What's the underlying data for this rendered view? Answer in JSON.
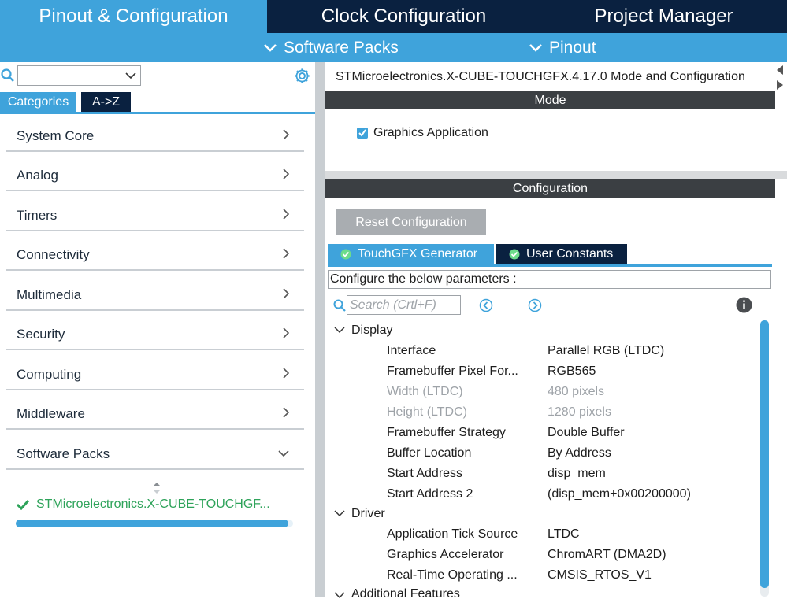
{
  "top_tabs": [
    "Pinout & Configuration",
    "Clock Configuration",
    "Project Manager"
  ],
  "subbar": {
    "software_packs": "Software Packs",
    "pinout": "Pinout"
  },
  "left": {
    "tab_categories": "Categories",
    "tab_az": "A->Z",
    "categories": [
      "System Core",
      "Analog",
      "Timers",
      "Connectivity",
      "Multimedia",
      "Security",
      "Computing",
      "Middleware",
      "Software Packs"
    ],
    "package": "STMicroelectronics.X-CUBE-TOUCHGF..."
  },
  "right": {
    "title": "STMicroelectronics.X-CUBE-TOUCHGFX.4.17.0 Mode and Configuration",
    "mode_header": "Mode",
    "graphics_app": "Graphics Application",
    "config_header": "Configuration",
    "reset_button": "Reset Configuration",
    "tab_generator": "TouchGFX Generator",
    "tab_constants": "User Constants",
    "configure_text": "Configure the below parameters :",
    "search_placeholder": "Search (Crtl+F)",
    "groups": {
      "display": "Display",
      "driver": "Driver",
      "additional": "Additional Features"
    },
    "params": [
      {
        "name": "Interface",
        "value": "Parallel RGB (LTDC)"
      },
      {
        "name": "Framebuffer Pixel For...",
        "value": "RGB565"
      },
      {
        "name": "Width (LTDC)",
        "value": "480 pixels"
      },
      {
        "name": "Height (LTDC)",
        "value": "1280 pixels"
      },
      {
        "name": "Framebuffer Strategy",
        "value": "Double Buffer"
      },
      {
        "name": "Buffer Location",
        "value": "By Address"
      },
      {
        "name": "Start Address",
        "value": "disp_mem"
      },
      {
        "name": "Start Address 2",
        "value": "(disp_mem+0x00200000)"
      },
      {
        "name": "Application Tick Source",
        "value": "LTDC"
      },
      {
        "name": "Graphics Accelerator",
        "value": "ChromART (DMA2D)"
      },
      {
        "name": "Real-Time Operating ...",
        "value": "CMSIS_RTOS_V1"
      }
    ]
  },
  "colors": {
    "accent": "#3fa3db",
    "navy": "#0a2140",
    "section": "#3b3f43",
    "success": "#2ea35a"
  }
}
